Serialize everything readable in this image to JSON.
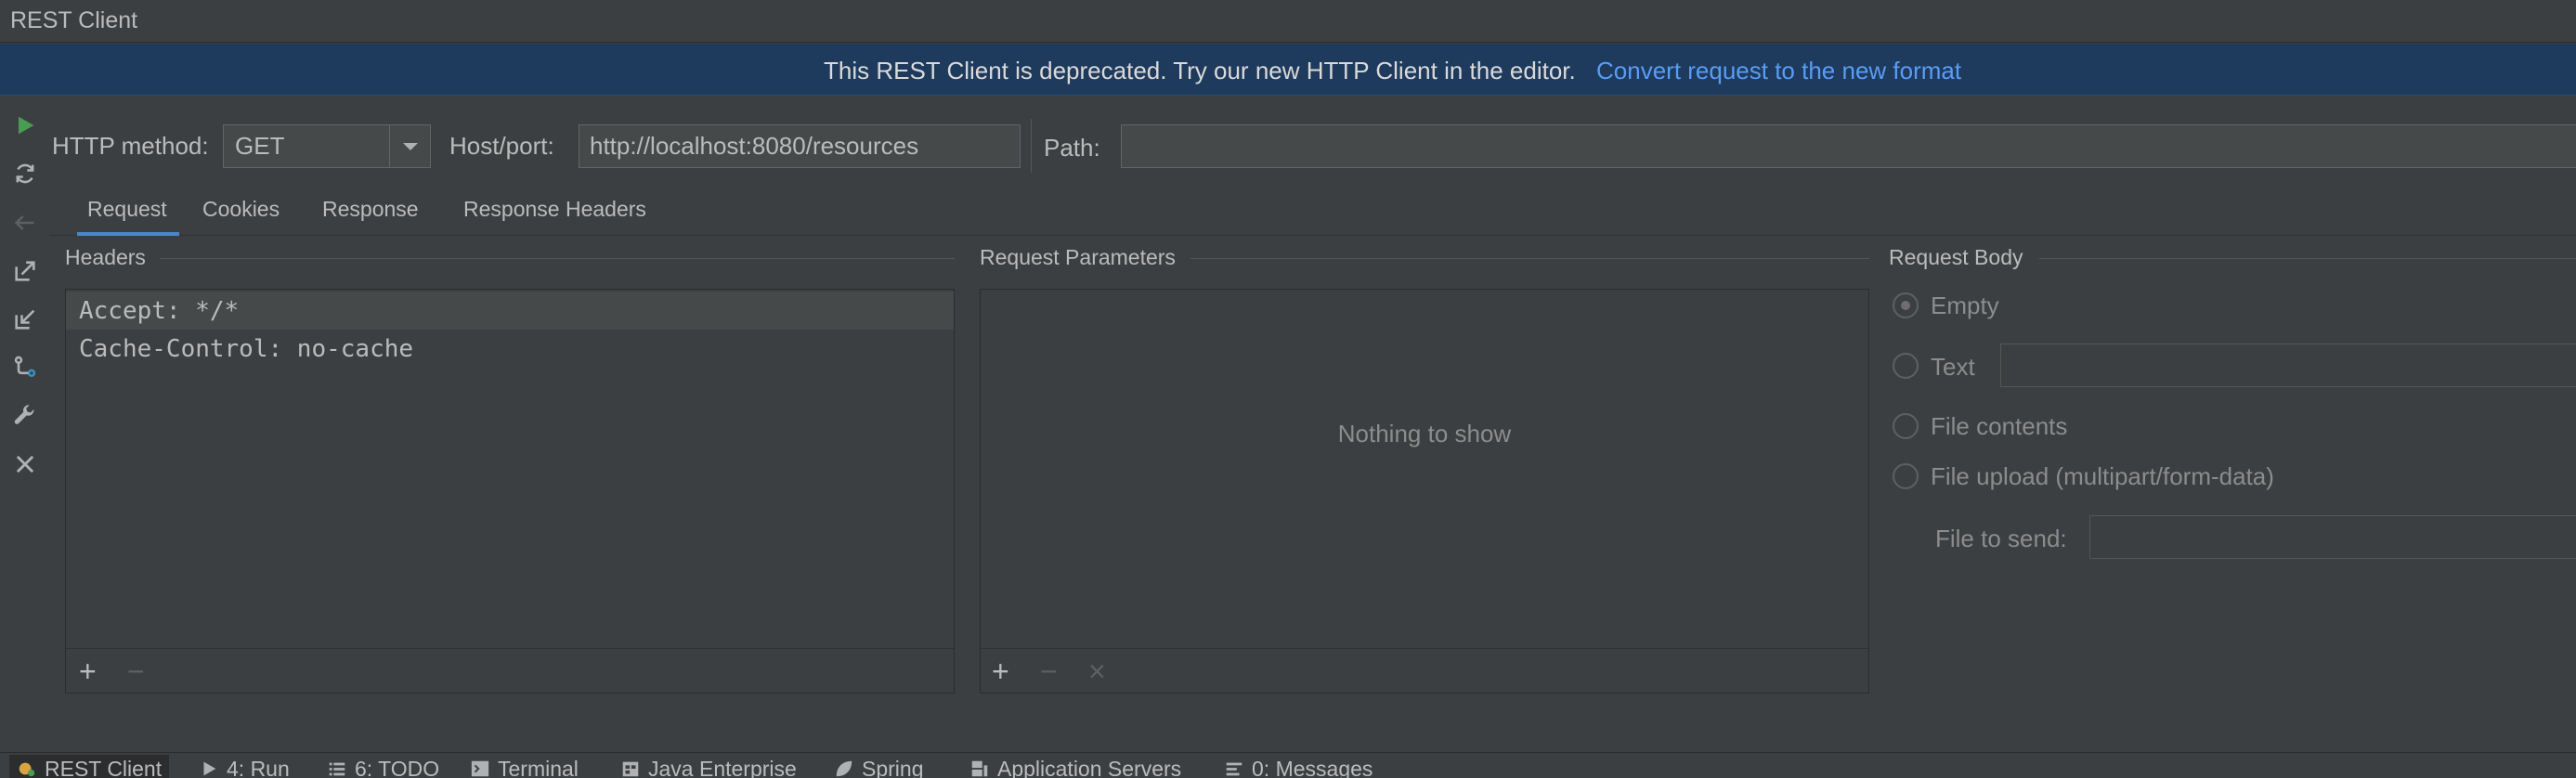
{
  "window": {
    "title": "REST Client"
  },
  "banner": {
    "message": "This REST Client is deprecated. Try our new HTTP Client in the editor.",
    "link": "Convert request to the new format"
  },
  "toolbar": {
    "icons": [
      "run-icon",
      "refresh-icon",
      "back-icon",
      "export-icon",
      "import-icon",
      "vcs-icon",
      "wrench-icon",
      "close-icon"
    ]
  },
  "request": {
    "method_label": "HTTP method:",
    "method_value": "GET",
    "host_label": "Host/port:",
    "host_value": "http://localhost:8080/resources",
    "path_label": "Path:",
    "path_value": ""
  },
  "tabs": [
    {
      "label": "Request",
      "active": true
    },
    {
      "label": "Cookies",
      "active": false
    },
    {
      "label": "Response",
      "active": false
    },
    {
      "label": "Response Headers",
      "active": false
    }
  ],
  "headers_section": {
    "title": "Headers",
    "rows": [
      "Accept: */*",
      "Cache-Control: no-cache"
    ],
    "add": "+",
    "remove": "−"
  },
  "params_section": {
    "title": "Request Parameters",
    "empty_text": "Nothing to show",
    "add": "+",
    "remove": "−",
    "clear": "×"
  },
  "body_section": {
    "title": "Request Body",
    "options": [
      {
        "label": "Empty",
        "checked": true
      },
      {
        "label": "Text",
        "checked": false
      },
      {
        "label": "File contents",
        "checked": false
      },
      {
        "label": "File upload (multipart/form-data)",
        "checked": false
      }
    ],
    "file_to_send_label": "File to send:"
  },
  "bottom_bar": [
    {
      "label": "REST Client",
      "active": true
    },
    {
      "label": "4: Run",
      "active": false
    },
    {
      "label": "6: TODO",
      "active": false
    },
    {
      "label": "Terminal",
      "active": false
    },
    {
      "label": "Java Enterprise",
      "active": false
    },
    {
      "label": "Spring",
      "active": false
    },
    {
      "label": "Application Servers",
      "active": false
    },
    {
      "label": "0: Messages",
      "active": false
    }
  ],
  "colors": {
    "background": "#3c3f41",
    "banner": "#1e3a5c",
    "link": "#589df6",
    "run_green": "#499c54",
    "tab_underline": "#4a88c7"
  }
}
